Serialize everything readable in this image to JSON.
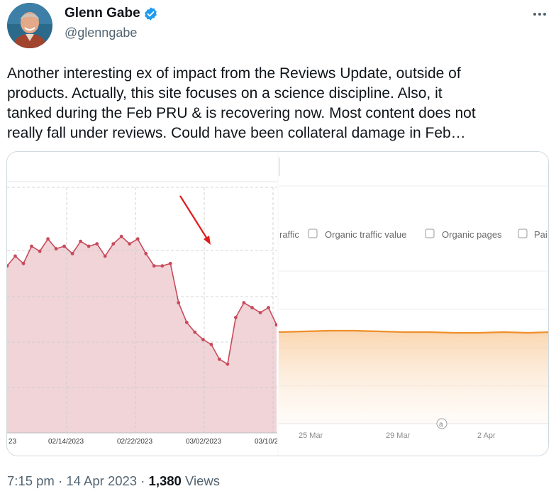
{
  "author": {
    "name": "Glenn Gabe",
    "handle": "@glenngabe",
    "avatar_icon": "person-avatar",
    "verified_color": "#1d9bf0"
  },
  "tweet": {
    "lines": [
      "Another interesting ex of impact from the Reviews Update, outside of",
      "products. Actually, this site focuses on a science discipline. Also, it",
      "tanked during the Feb PRU & is recovering now. Most content does not",
      "really fall under reviews. Could have been collateral damage in Feb…"
    ]
  },
  "meta": {
    "time": "7:15 pm",
    "separator": "·",
    "date": "14 Apr 2023",
    "views_count": "1,380",
    "views_label": "Views"
  },
  "chart_data": [
    {
      "type": "area",
      "color": "#c84a5a",
      "x_tick_labels": [
        "23",
        "02/14/2023",
        "02/22/2023",
        "03/02/2023",
        "03/10/2"
      ],
      "values": [
        0.68,
        0.72,
        0.69,
        0.76,
        0.74,
        0.79,
        0.75,
        0.76,
        0.73,
        0.78,
        0.76,
        0.77,
        0.72,
        0.77,
        0.8,
        0.77,
        0.79,
        0.73,
        0.68,
        0.68,
        0.69,
        0.53,
        0.45,
        0.41,
        0.38,
        0.36,
        0.3,
        0.28,
        0.47,
        0.53,
        0.51,
        0.49,
        0.51,
        0.44
      ],
      "annotation": "red arrow pointing to drop"
    },
    {
      "type": "area",
      "color": "#f0a03c",
      "legend": [
        "raffic",
        "Organic traffic value",
        "Organic pages",
        "Pai"
      ],
      "x_tick_labels": [
        "25 Mar",
        "29 Mar",
        "2 Apr"
      ],
      "marker_label": "a"
    }
  ]
}
